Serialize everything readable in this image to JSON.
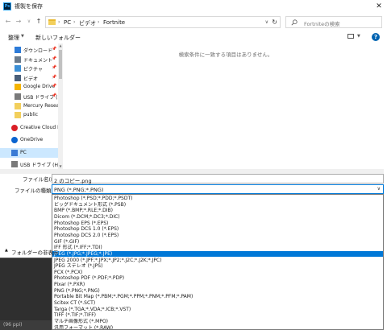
{
  "window": {
    "title": "複製を保存",
    "app_icon": "Ps",
    "close_icon": "✕"
  },
  "nav": {
    "back": "←",
    "forward": "→",
    "recent": "∨",
    "up": "↑",
    "breadcrumbs": [
      "PC",
      "ビデオ",
      "Fortnite"
    ],
    "separator": "›",
    "search_placeholder": "Fortniteの検索"
  },
  "toolbar": {
    "organize": "整理",
    "new_folder": "新しいフォルダー",
    "help": "?"
  },
  "sidebar": {
    "items": [
      {
        "label": "ダウンロード",
        "icon": "download-icon",
        "pinned": true
      },
      {
        "label": "ドキュメント",
        "icon": "documents-icon",
        "pinned": true
      },
      {
        "label": "ピクチャ",
        "icon": "pictures-icon",
        "pinned": true
      },
      {
        "label": "ビデオ",
        "icon": "videos-icon",
        "pinned": true
      },
      {
        "label": "Google Drive",
        "icon": "google-drive-icon",
        "pinned": true
      },
      {
        "label": "USB ドライブ (H",
        "icon": "usb-drive-icon",
        "pinned": true
      },
      {
        "label": "Mercury Researc",
        "icon": "folder-icon",
        "pinned": false
      },
      {
        "label": "public",
        "icon": "folder-icon",
        "pinned": false
      },
      {
        "label": "Creative Cloud File",
        "icon": "creative-cloud-icon",
        "pinned": false
      },
      {
        "label": "OneDrive",
        "icon": "onedrive-icon",
        "pinned": false
      },
      {
        "label": "PC",
        "icon": "pc-icon",
        "pinned": false,
        "selected": true
      },
      {
        "label": "USB ドライブ (H:)",
        "icon": "usb-drive-icon",
        "pinned": false
      }
    ]
  },
  "content": {
    "empty_message": "検索条件に一致する項目はありません。"
  },
  "form": {
    "filename_label": "ファイル名(N):",
    "filename_value": "2 のコピー.png",
    "filetype_label": "ファイルの種類(T):",
    "filetype_value": "PNG (*.PNG;*.PNG)",
    "hide_folders": "フォルダーの非表示"
  },
  "filetypes": [
    "Photoshop (*.PSD;*.PDD;*.PSDT)",
    "ビッグドキュメント形式 (*.PSB)",
    "BMP (*.BMP;*.RLE;*.DIB)",
    "Dicom (*.DCM;*.DC3;*.DIC)",
    "Photoshop EPS (*.EPS)",
    "Photoshop DCS 1.0 (*.EPS)",
    "Photoshop DCS 2.0 (*.EPS)",
    "GIF (*.GIF)",
    "IFF 形式 (*.IFF;*.TDI)",
    "JPEG (*.JPG;*.JPEG;*.JPE)",
    "JPEG 2000 (*.JPF;*.JPX;*.JP2;*.J2C;*.J2K;*.JPC)",
    "JPEG ステレオ (*.JPS)",
    "PCX (*.PCX)",
    "Photoshop PDF (*.PDF;*.PDP)",
    "Pixar (*.PXR)",
    "PNG (*.PNG;*.PNG)",
    "Portable Bit Map (*.PBM;*.PGM;*.PPM;*.PNM;*.PFM;*.PAM)",
    "Scitex CT (*.SCT)",
    "Targa (*.TGA;*.VDA;*.ICB;*.VST)",
    "TIFF (*.TIF;*.TIFF)",
    "マルチ画像形式 (*.MPO)",
    "汎用フォーマット (*.RAW)"
  ],
  "selected_filetype_index": 9,
  "status_text": "(96 ppi)",
  "colors": {
    "accent": "#0078d7",
    "selection_bg": "#cce8ff",
    "folder": "#f2cf5c"
  }
}
